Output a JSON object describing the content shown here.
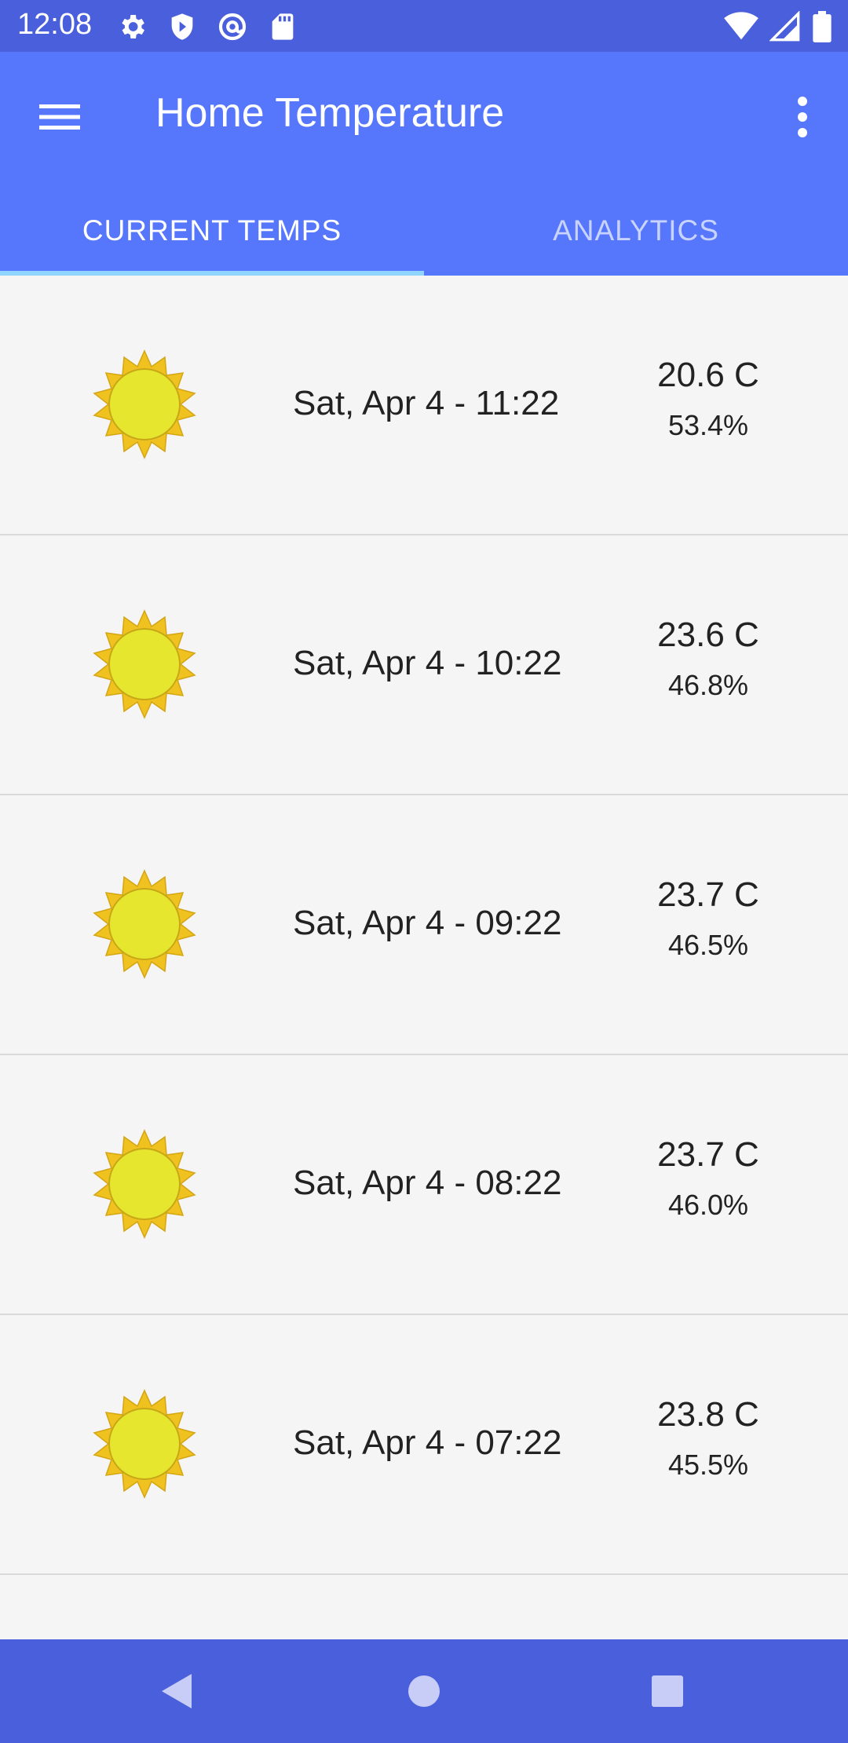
{
  "status_bar": {
    "time": "12:08",
    "icons_left": [
      "settings-icon",
      "shield-icon",
      "at-sign-icon",
      "sd-card-icon"
    ],
    "icons_right": [
      "wifi-icon",
      "signal-icon",
      "battery-icon"
    ]
  },
  "app_bar": {
    "title": "Home Temperature",
    "menu_icon": "hamburger-icon",
    "overflow_icon": "more-vert-icon",
    "color": "#5677fc"
  },
  "tabs": [
    {
      "label": "CURRENT TEMPS",
      "active": true
    },
    {
      "label": "ANALYTICS",
      "active": false
    }
  ],
  "readings": [
    {
      "datetime": "Sat, Apr 4 - 11:22",
      "temperature": "20.6 C",
      "humidity": "53.4%",
      "icon": "sun-icon"
    },
    {
      "datetime": "Sat, Apr 4 - 10:22",
      "temperature": "23.6 C",
      "humidity": "46.8%",
      "icon": "sun-icon"
    },
    {
      "datetime": "Sat, Apr 4 - 09:22",
      "temperature": "23.7 C",
      "humidity": "46.5%",
      "icon": "sun-icon"
    },
    {
      "datetime": "Sat, Apr 4 - 08:22",
      "temperature": "23.7 C",
      "humidity": "46.0%",
      "icon": "sun-icon"
    },
    {
      "datetime": "Sat, Apr 4 - 07:22",
      "temperature": "23.8 C",
      "humidity": "45.5%",
      "icon": "sun-icon"
    }
  ],
  "nav_bar": {
    "icons": [
      "back-icon",
      "home-icon",
      "recents-icon"
    ]
  }
}
